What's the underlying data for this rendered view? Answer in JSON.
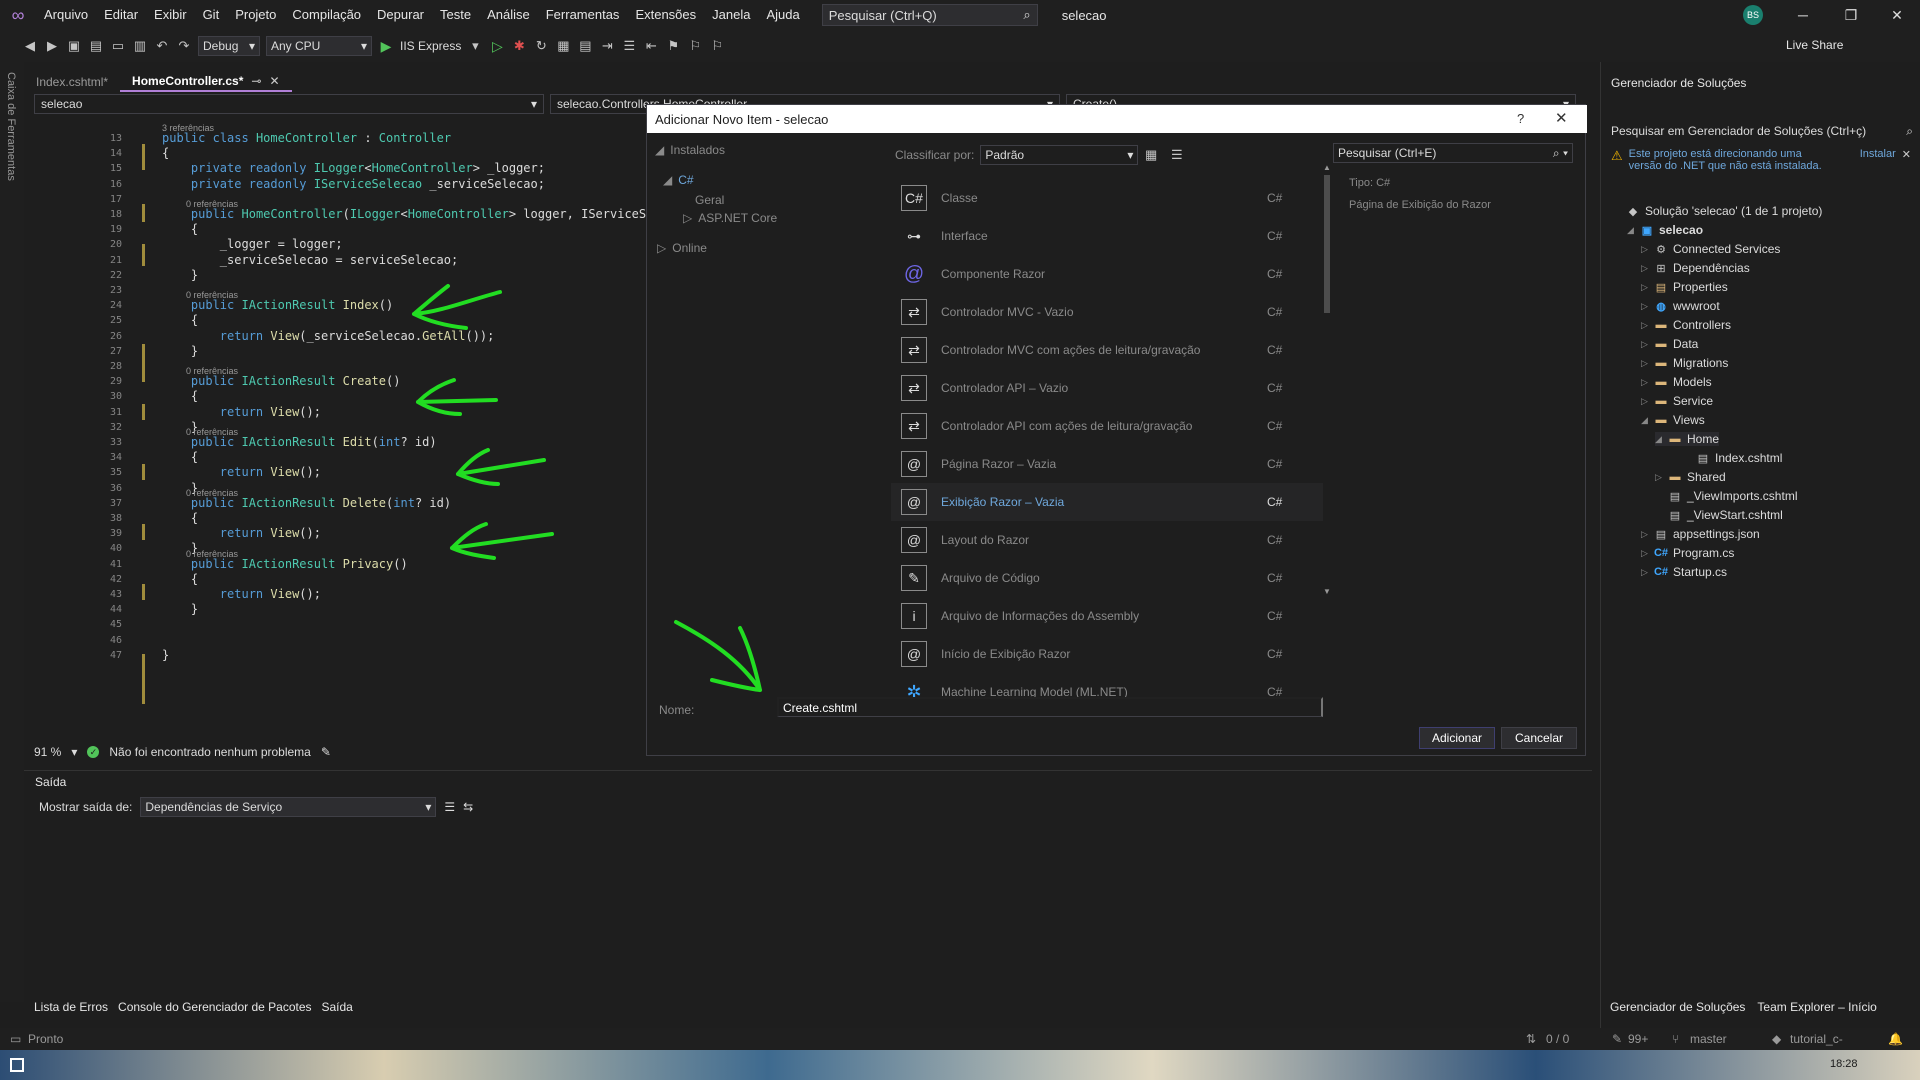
{
  "menu": {
    "items": [
      "Arquivo",
      "Editar",
      "Exibir",
      "Git",
      "Projeto",
      "Compilação",
      "Depurar",
      "Teste",
      "Análise",
      "Ferramentas",
      "Extensões",
      "Janela",
      "Ajuda"
    ],
    "search_label": "Pesquisar (Ctrl+Q)",
    "solution_name": "selecao",
    "user_initials": "BS"
  },
  "toolbar": {
    "config": "Debug",
    "platform": "Any CPU",
    "run_target": "IIS Express",
    "live_share": "Live Share"
  },
  "toolbox_strip": "Caixa de Ferramentas",
  "tabs": [
    {
      "label": "Index.cshtml*",
      "active": false
    },
    {
      "label": "HomeController.cs*",
      "active": true
    }
  ],
  "nav": {
    "project": "selecao",
    "class": "selecao.Controllers.HomeController",
    "member": "Create()"
  },
  "code": {
    "codelens": [
      "3 referências",
      "0 referências",
      "0 referências",
      "0 referências",
      "0 referências",
      "0 referências",
      "0 referências"
    ],
    "line_numbers": [
      "13",
      "14",
      "15",
      "16",
      "17",
      "18",
      "19",
      "20",
      "21",
      "22",
      "23",
      "24",
      "25",
      "26",
      "27",
      "28",
      "29",
      "30",
      "31",
      "32",
      "33",
      "34",
      "35",
      "36",
      "37",
      "38",
      "39",
      "40",
      "41",
      "42",
      "43",
      "44",
      "45",
      "46",
      "47"
    ],
    "lines": [
      "public class HomeController : Controller",
      "{",
      "    private readonly ILogger<HomeController> _logger;",
      "    private readonly IServiceSelecao _serviceSelecao;",
      "",
      "    public HomeController(ILogger<HomeController> logger, IServiceSele",
      "    {",
      "        _logger = logger;",
      "        _serviceSelecao = serviceSelecao;",
      "    }",
      "",
      "    public IActionResult Index()",
      "    {",
      "        return View(_serviceSelecao.GetAll());",
      "    }",
      "",
      "    public IActionResult Create()",
      "    {",
      "        return View();",
      "    }",
      "    public IActionResult Edit(int? id)",
      "    {",
      "        return View();",
      "    }",
      "    public IActionResult Delete(int? id)",
      "    {",
      "        return View();",
      "    }",
      "    public IActionResult Privacy()",
      "    {",
      "        return View();",
      "    }",
      "",
      "",
      "}"
    ]
  },
  "editor_status": {
    "zoom": "91 %",
    "issues": "Não foi encontrado nenhum problema"
  },
  "output": {
    "title": "Saída",
    "show_from_label": "Mostrar saída de:",
    "source": "Dependências de Serviço"
  },
  "bottom_tabs": [
    "Lista de Erros",
    "Console do Gerenciador de Pacotes",
    "Saída"
  ],
  "status": {
    "ready": "Pronto",
    "lines": "0 / 0",
    "edits": "99+",
    "branch": "master",
    "repo": "tutorial_c-",
    "time": "18:28"
  },
  "solution_explorer": {
    "title": "Gerenciador de Soluções",
    "search": "Pesquisar em Gerenciador de Soluções (Ctrl+ç)",
    "warning": "Este projeto está direcionando uma versão do .NET que não está instalada.",
    "install": "Instalar",
    "solution": "Solução 'selecao' (1 de 1 projeto)",
    "project": "selecao",
    "items": {
      "connected": "Connected Services",
      "deps": "Dependências",
      "properties": "Properties",
      "wwwroot": "wwwroot",
      "controllers": "Controllers",
      "data": "Data",
      "migrations": "Migrations",
      "models": "Models",
      "service": "Service",
      "views": "Views",
      "home": "Home",
      "index": "Index.cshtml",
      "shared": "Shared",
      "viewimports": "_ViewImports.cshtml",
      "viewstart": "_ViewStart.cshtml",
      "appsettings": "appsettings.json",
      "program": "Program.cs",
      "startup": "Startup.cs"
    },
    "bottom_tabs": [
      "Gerenciador de Soluções",
      "Team Explorer – Início"
    ]
  },
  "dialog": {
    "title": "Adicionar Novo Item - selecao",
    "help": "?",
    "categories": {
      "installed": "Instalados",
      "csharp": "C#",
      "general": "Geral",
      "aspnet": "ASP.NET Core",
      "online": "Online"
    },
    "sort_label": "Classificar por:",
    "sort_value": "Padrão",
    "search": "Pesquisar (Ctrl+E)",
    "templates": [
      {
        "name": "Classe",
        "lang": "C#",
        "icon": "class-icon"
      },
      {
        "name": "Interface",
        "lang": "C#",
        "icon": "interface-icon"
      },
      {
        "name": "Componente Razor",
        "lang": "C#",
        "icon": "razor-component-icon"
      },
      {
        "name": "Controlador MVC - Vazio",
        "lang": "C#",
        "icon": "controller-icon"
      },
      {
        "name": "Controlador MVC com ações de leitura/gravação",
        "lang": "C#",
        "icon": "controller-icon"
      },
      {
        "name": "Controlador API – Vazio",
        "lang": "C#",
        "icon": "controller-icon"
      },
      {
        "name": "Controlador API com ações de leitura/gravação",
        "lang": "C#",
        "icon": "controller-icon"
      },
      {
        "name": "Página Razor – Vazia",
        "lang": "C#",
        "icon": "razor-page-icon"
      },
      {
        "name": "Exibição Razor – Vazia",
        "lang": "C#",
        "icon": "razor-view-icon"
      },
      {
        "name": "Layout do Razor",
        "lang": "C#",
        "icon": "razor-layout-icon"
      },
      {
        "name": "Arquivo de Código",
        "lang": "C#",
        "icon": "code-file-icon"
      },
      {
        "name": "Arquivo de Informações do Assembly",
        "lang": "C#",
        "icon": "assembly-info-icon"
      },
      {
        "name": "Início de Exibição Razor",
        "lang": "C#",
        "icon": "razor-viewstart-icon"
      },
      {
        "name": "Machine Learning Model (ML.NET)",
        "lang": "C#",
        "icon": "ml-model-icon"
      }
    ],
    "type_label": "Tipo:  C#",
    "type_desc": "Página de Exibição do Razor",
    "name_label": "Nome:",
    "name_value": "Create.cshtml",
    "add": "Adicionar",
    "cancel": "Cancelar"
  },
  "colors": {
    "accent": "#b180d7",
    "annotation": "#22dd22",
    "link": "#6fa8dc"
  }
}
